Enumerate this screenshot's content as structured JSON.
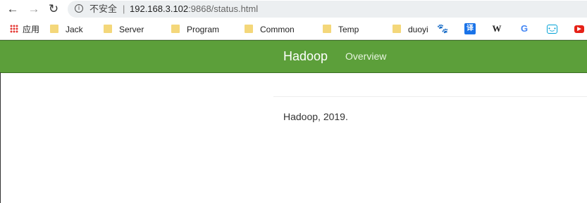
{
  "browser": {
    "security_label": "不安全",
    "separator": "|",
    "url_host": "192.168.3.102",
    "url_rest": ":9868/status.html",
    "back_glyph": "←",
    "forward_glyph": "→",
    "reload_glyph": "↻",
    "info_glyph": "i"
  },
  "bookmarks": {
    "apps_label": "应用",
    "folders": [
      "Jack",
      "Server",
      "Program",
      "Common",
      "Temp",
      "duoyi"
    ],
    "icons": [
      {
        "name": "baidu-icon",
        "glyph": "🐾"
      },
      {
        "name": "fanyi-icon",
        "glyph": "译"
      },
      {
        "name": "wikipedia-icon",
        "glyph": "W"
      },
      {
        "name": "google-icon",
        "glyph": "G"
      },
      {
        "name": "bilibili-icon",
        "glyph": "•‿•"
      },
      {
        "name": "youtube-icon",
        "glyph": "▶"
      }
    ]
  },
  "navbar": {
    "brand": "Hadoop",
    "links": [
      "Overview"
    ],
    "background": "#5c9f3a"
  },
  "footer": {
    "text": "Hadoop, 2019."
  }
}
